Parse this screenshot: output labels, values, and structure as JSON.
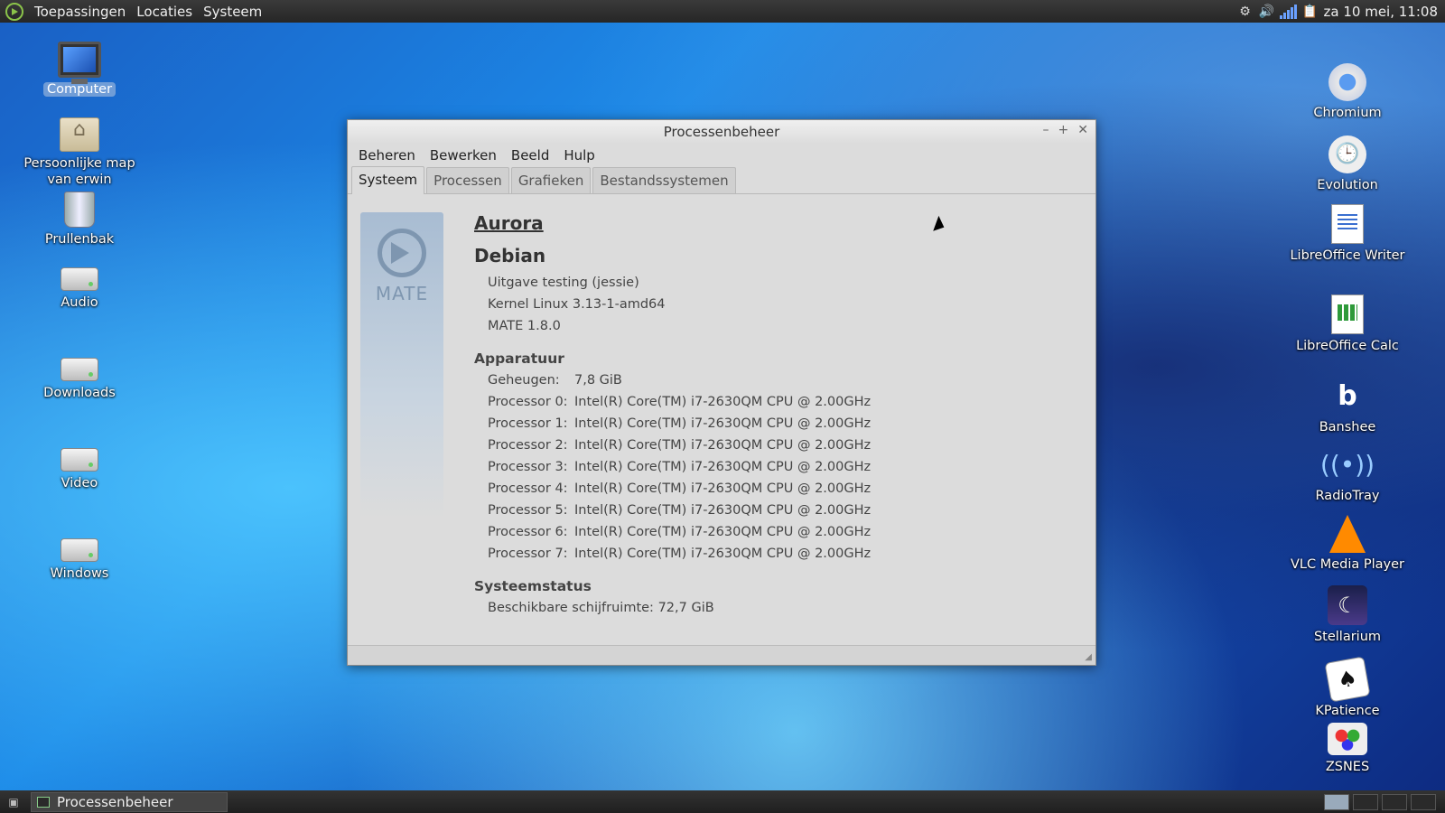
{
  "top_panel": {
    "menus": [
      "Toepassingen",
      "Locaties",
      "Systeem"
    ],
    "clock": "za 10 mei, 11:08"
  },
  "desktop_left": [
    {
      "label": "Computer",
      "icon": "computer-icon",
      "selected": true
    },
    {
      "label": "Persoonlijke map van erwin",
      "icon": "home-folder-icon"
    },
    {
      "label": "Prullenbak",
      "icon": "trash-icon"
    },
    {
      "label": "Audio",
      "icon": "drive-icon"
    },
    {
      "label": "Downloads",
      "icon": "drive-icon"
    },
    {
      "label": "Video",
      "icon": "drive-icon"
    },
    {
      "label": "Windows",
      "icon": "drive-icon"
    }
  ],
  "desktop_right": [
    {
      "label": "Chromium",
      "icon": "chromium-icon"
    },
    {
      "label": "Evolution",
      "icon": "evolution-icon"
    },
    {
      "label": "LibreOffice Writer",
      "icon": "libreoffice-writer-icon"
    },
    {
      "label": "LibreOffice Calc",
      "icon": "libreoffice-calc-icon"
    },
    {
      "label": "Banshee",
      "icon": "banshee-icon"
    },
    {
      "label": "RadioTray",
      "icon": "radiotray-icon"
    },
    {
      "label": "VLC Media Player",
      "icon": "vlc-icon"
    },
    {
      "label": "Stellarium",
      "icon": "stellarium-icon"
    },
    {
      "label": "KPatience",
      "icon": "kpatience-icon"
    },
    {
      "label": "ZSNES",
      "icon": "zsnes-icon"
    }
  ],
  "window": {
    "title": "Processenbeheer",
    "menu": [
      "Beheren",
      "Bewerken",
      "Beeld",
      "Hulp"
    ],
    "tabs": [
      "Systeem",
      "Processen",
      "Grafieken",
      "Bestandssystemen"
    ],
    "active_tab": "Systeem",
    "logo_text": "MATE",
    "hostname": "Aurora",
    "distro": "Debian",
    "distro_lines": [
      "Uitgave testing (jessie)",
      "Kernel Linux 3.13-1-amd64",
      "MATE 1.8.0"
    ],
    "hardware_title": "Apparatuur",
    "memory_label": "Geheugen:",
    "memory_value": "7,8 GiB",
    "processors": [
      {
        "label": "Processor 0:",
        "value": "Intel(R) Core(TM) i7-2630QM CPU @ 2.00GHz"
      },
      {
        "label": "Processor 1:",
        "value": "Intel(R) Core(TM) i7-2630QM CPU @ 2.00GHz"
      },
      {
        "label": "Processor 2:",
        "value": "Intel(R) Core(TM) i7-2630QM CPU @ 2.00GHz"
      },
      {
        "label": "Processor 3:",
        "value": "Intel(R) Core(TM) i7-2630QM CPU @ 2.00GHz"
      },
      {
        "label": "Processor 4:",
        "value": "Intel(R) Core(TM) i7-2630QM CPU @ 2.00GHz"
      },
      {
        "label": "Processor 5:",
        "value": "Intel(R) Core(TM) i7-2630QM CPU @ 2.00GHz"
      },
      {
        "label": "Processor 6:",
        "value": "Intel(R) Core(TM) i7-2630QM CPU @ 2.00GHz"
      },
      {
        "label": "Processor 7:",
        "value": "Intel(R) Core(TM) i7-2630QM CPU @ 2.00GHz"
      }
    ],
    "status_title": "Systeemstatus",
    "disk_label": "Beschikbare schijfruimte:",
    "disk_value": "72,7 GiB"
  },
  "taskbar": {
    "task_label": "Processenbeheer"
  }
}
